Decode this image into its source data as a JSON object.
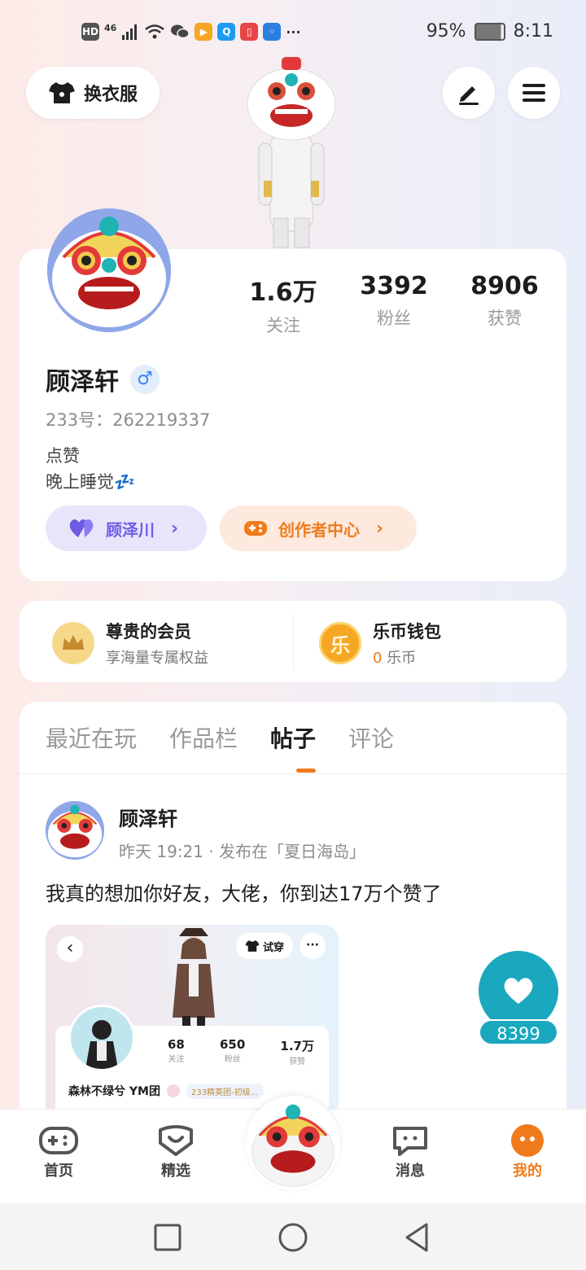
{
  "status_bar": {
    "network": "HD",
    "signal": "46",
    "battery_percent": "95%",
    "time": "8:11",
    "app_icons": [
      "wechat-icon",
      "video-app-icon",
      "search-app-icon",
      "book-app-icon",
      "bulb-app-icon"
    ],
    "more": "···"
  },
  "header": {
    "outfit_label": "换衣服",
    "edit_icon": "pen-icon",
    "menu_icon": "menu-icon"
  },
  "profile": {
    "name": "顾泽轩",
    "gender_symbol": "♂",
    "uid": "233号：262219337",
    "bio_line1": "点赞",
    "bio_line2": "晚上睡觉💤",
    "stats": [
      {
        "value": "1.6万",
        "label": "关注"
      },
      {
        "value": "3392",
        "label": "粉丝"
      },
      {
        "value": "8906",
        "label": "获赞"
      }
    ],
    "friend_pill": "顾泽川",
    "creator_pill": "创作者中心",
    "friend_color": "#6e5ce6",
    "creator_color": "#f07b1c"
  },
  "vip": {
    "member_title": "尊贵的会员",
    "member_sub": "享海量专属权益",
    "wallet_title": "乐币钱包",
    "wallet_amount": "0",
    "wallet_unit": " 乐币",
    "coin_char": "乐"
  },
  "tabs": {
    "items": [
      "最近在玩",
      "作品栏",
      "帖子",
      "评论"
    ],
    "active_index": 2,
    "accent": "#f07b1c"
  },
  "post": {
    "author": "顾泽轩",
    "meta": "昨天 19:21 · 发布在「夏日海岛」",
    "text": "我真的想加你好友，大佬，你到达17万个赞了",
    "like_count": "8399",
    "screenshot": {
      "try_label": "试穿",
      "more": "···",
      "stats": [
        {
          "value": "68",
          "label": "关注"
        },
        {
          "value": "650",
          "label": "粉丝"
        },
        {
          "value": "1.7万",
          "label": "获赞"
        }
      ],
      "user_name": "森林不绿兮 YM团",
      "badge": "233精英团-初级…"
    }
  },
  "bottom_nav": {
    "items": [
      {
        "label": "首页",
        "icon": "gamepad-icon"
      },
      {
        "label": "精选",
        "icon": "heart-chat-icon"
      },
      {
        "label": "消息",
        "icon": "message-icon"
      },
      {
        "label": "我的",
        "icon": "me-icon"
      }
    ],
    "active_label_color": "#f07b1c"
  }
}
